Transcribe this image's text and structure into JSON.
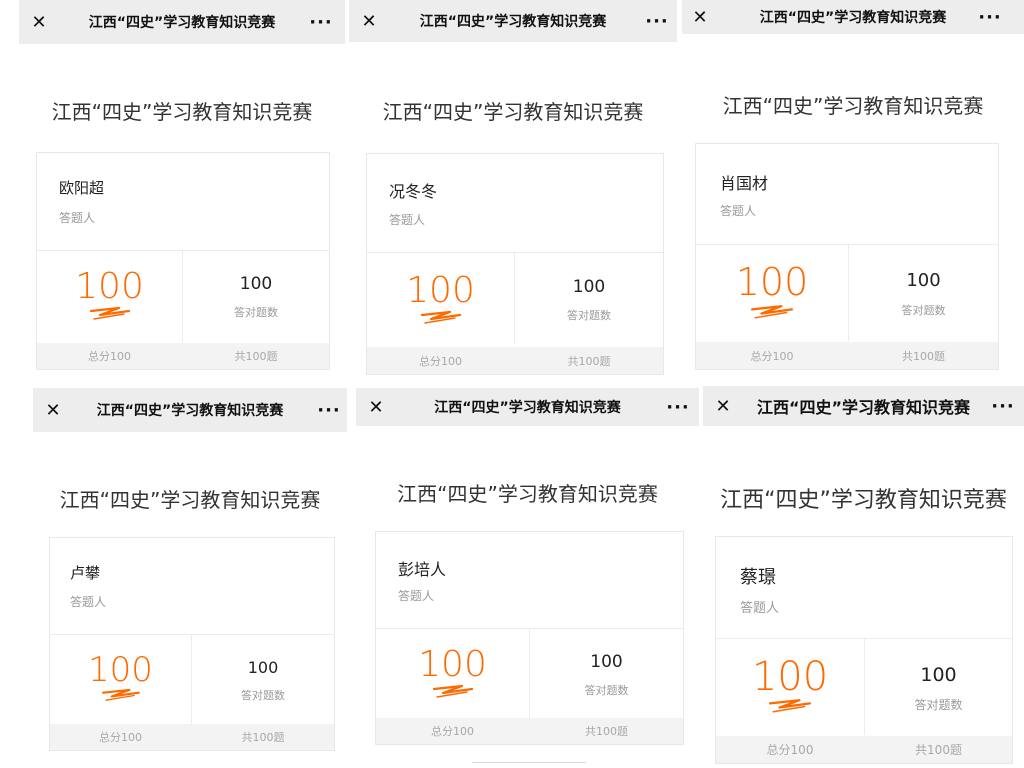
{
  "colors": {
    "accent": "#ff6a00",
    "navbar_bg": "#ededed",
    "footer_bg": "#f3f3f3"
  },
  "icons": {
    "close": "close-icon",
    "more": "more-icon",
    "score_mark": "score-underline-mark"
  },
  "panels": [
    {
      "nav": {
        "close": "✕",
        "title": "江西“四史”学习教育知识竞赛",
        "more": "···"
      },
      "page_title": "江西“四史”学习教育知识竞赛",
      "name": "欧阳超",
      "role": "答题人",
      "score": "100",
      "correct_count": "100",
      "correct_label": "答对题数",
      "total_score": "总分100",
      "total_questions": "共100题"
    },
    {
      "nav": {
        "close": "✕",
        "title": "江西“四史”学习教育知识竞赛",
        "more": "···"
      },
      "page_title": "江西“四史”学习教育知识竞赛",
      "name": "况冬冬",
      "role": "答题人",
      "score": "100",
      "correct_count": "100",
      "correct_label": "答对题数",
      "total_score": "总分100",
      "total_questions": "共100题"
    },
    {
      "nav": {
        "close": "✕",
        "title": "江西“四史”学习教育知识竞赛",
        "more": "···"
      },
      "page_title": "江西“四史”学习教育知识竞赛",
      "name": "肖国材",
      "role": "答题人",
      "score": "100",
      "correct_count": "100",
      "correct_label": "答对题数",
      "total_score": "总分100",
      "total_questions": "共100题"
    },
    {
      "nav": {
        "close": "✕",
        "title": "江西“四史”学习教育知识竞赛",
        "more": "···"
      },
      "page_title": "江西“四史”学习教育知识竞赛",
      "name": "卢攀",
      "role": "答题人",
      "score": "100",
      "correct_count": "100",
      "correct_label": "答对题数",
      "total_score": "总分100",
      "total_questions": "共100题"
    },
    {
      "nav": {
        "close": "✕",
        "title": "江西“四史”学习教育知识竞赛",
        "more": "···"
      },
      "page_title": "江西“四史”学习教育知识竞赛",
      "name": "彭培人",
      "role": "答题人",
      "score": "100",
      "correct_count": "100",
      "correct_label": "答对题数",
      "total_score": "总分100",
      "total_questions": "共100题"
    },
    {
      "nav": {
        "close": "✕",
        "title": "江西“四史”学习教育知识竞赛",
        "more": "···"
      },
      "page_title": "江西“四史”学习教育知识竞赛",
      "name": "蔡璟",
      "role": "答题人",
      "score": "100",
      "correct_count": "100",
      "correct_label": "答对题数",
      "total_score": "总分100",
      "total_questions": "共100题"
    }
  ]
}
